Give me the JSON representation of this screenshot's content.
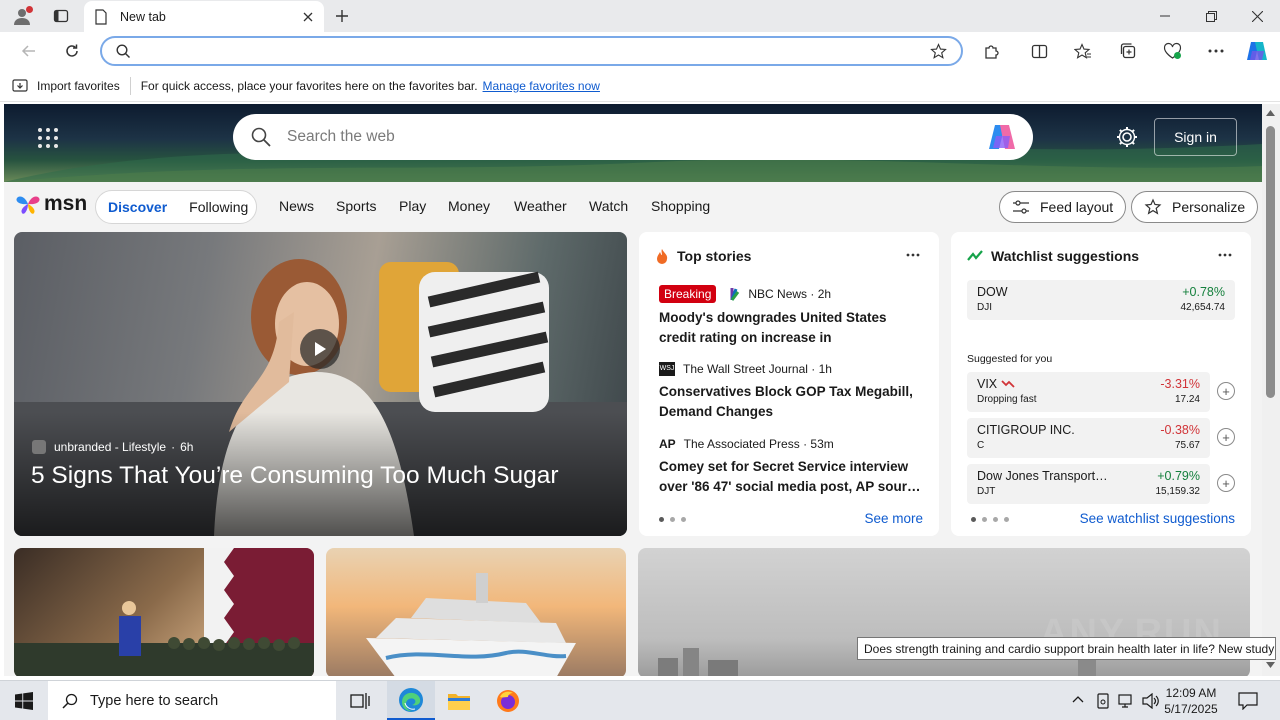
{
  "browser": {
    "tab_title": "New tab",
    "address_value": "",
    "favbar": {
      "import_label": "Import favorites",
      "message": "For quick access, place your favorites here on the favorites bar.",
      "manage_link": "Manage favorites now"
    }
  },
  "msn": {
    "search_placeholder": "Search the web",
    "signin_label": "Sign in",
    "logo_text": "msn",
    "pill_tabs": [
      "Discover",
      "Following"
    ],
    "nav_items": [
      "News",
      "Sports",
      "Play",
      "Money",
      "Weather",
      "Watch",
      "Shopping"
    ],
    "feed_layout_label": "Feed layout",
    "personalize_label": "Personalize",
    "main_story": {
      "source": "unbranded - Lifestyle",
      "age": "6h",
      "title": "5 Signs That You’re Consuming Too Much Sugar"
    },
    "top_stories": {
      "heading": "Top stories",
      "breaking_label": "Breaking",
      "items": [
        {
          "source": "NBC News · 2h",
          "title": "Moody's downgrades United States credit rating on increase in government…"
        },
        {
          "source": "The Wall Street Journal · 1h",
          "title": "Conservatives Block GOP Tax Megabill, Demand Changes"
        },
        {
          "source": "The Associated Press · 53m",
          "title": "Comey set for Secret Service interview over '86 47' social media post, AP sour…"
        }
      ],
      "see_more": "See more"
    },
    "watchlist": {
      "heading": "Watchlist suggestions",
      "suggested_label": "Suggested for you",
      "see_all": "See watchlist suggestions",
      "primary": {
        "name": "DOW",
        "symbol": "DJI",
        "change": "+0.78%",
        "price": "42,654.74"
      },
      "suggestions": [
        {
          "name": "VIX",
          "symbol": "Dropping fast",
          "change": "-3.31%",
          "price": "17.24"
        },
        {
          "name": "CITIGROUP INC.",
          "symbol": "C",
          "change": "-0.38%",
          "price": "75.67"
        },
        {
          "name": "Dow Jones Transport…",
          "symbol": "DJT",
          "change": "+0.79%",
          "price": "15,159.32"
        }
      ]
    },
    "tooltip": "Does strength training and cardio support brain health later in life? New study"
  },
  "watermark": "ANY.RUN",
  "taskbar": {
    "search_placeholder": "Type here to search",
    "time": "12:09 AM",
    "date": "5/17/2025"
  },
  "colors": {
    "accent": "#0f5bcf",
    "positive": "#15803d",
    "negative": "#d13438",
    "breaking": "#d20010"
  }
}
